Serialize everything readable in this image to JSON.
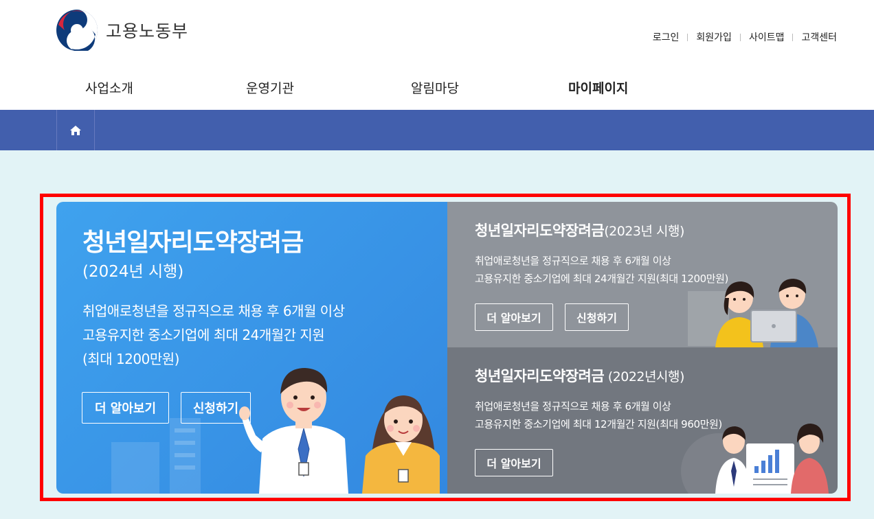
{
  "header": {
    "logo_text": "고용노동부",
    "util_links": [
      "로그인",
      "회원가입",
      "사이트맵",
      "고객센터"
    ],
    "nav": [
      "사업소개",
      "운영기관",
      "알림마당",
      "마이페이지"
    ]
  },
  "banner": {
    "main": {
      "title": "청년일자리도약장려금",
      "subtitle": "(2024년 시행)",
      "desc_line1": "취업애로청년을 정규직으로 채용 후 6개월 이상",
      "desc_line2": "고용유지한 중소기업에 최대 24개월간 지원",
      "desc_line3": "(최대 1200만원)",
      "learn_more": "더 알아보기",
      "apply": "신청하기"
    },
    "card2023": {
      "title": "청년일자리도약장려금",
      "year": "(2023년 시행)",
      "desc_line1": "취업애로청년을 정규직으로 채용 후 6개월 이상",
      "desc_line2": "고용유지한 중소기업에 최대 24개월간 지원(최대 1200만원)",
      "learn_more": "더 알아보기",
      "apply": "신청하기"
    },
    "card2022": {
      "title": "청년일자리도약장려금",
      "year": " (2022년시행)",
      "desc_line1": "취업애로청년을 정규직으로 채용 후 6개월 이상",
      "desc_line2": "고용유지한 중소기업에 최대 12개월간 지원(최대 960만원)",
      "learn_more": "더 알아보기"
    }
  },
  "colors": {
    "location_bar": "#425fad",
    "page_bg": "#e2f3f6",
    "main_card": "#3a95e8",
    "card2023": "#8f949b",
    "card2022": "#72777f",
    "highlight": "#ff0000"
  }
}
